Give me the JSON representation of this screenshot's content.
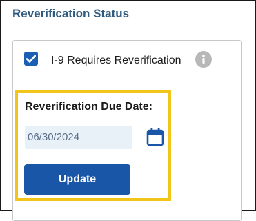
{
  "section": {
    "title": "Reverification Status"
  },
  "reverification": {
    "checkbox_checked": true,
    "checkbox_label": "I-9 Requires Reverification",
    "info_icon": "info-circle-icon"
  },
  "due_date": {
    "label": "Reverification Due Date:",
    "value": "06/30/2024",
    "calendar_icon": "calendar-icon"
  },
  "actions": {
    "update_label": "Update"
  },
  "colors": {
    "title": "#2f5b7f",
    "primary": "#1a56a8",
    "checkbox": "#1a5fb4",
    "highlight": "#f2c51a",
    "input_bg": "#e8f0f8",
    "info_icon": "#b8b8b8"
  }
}
